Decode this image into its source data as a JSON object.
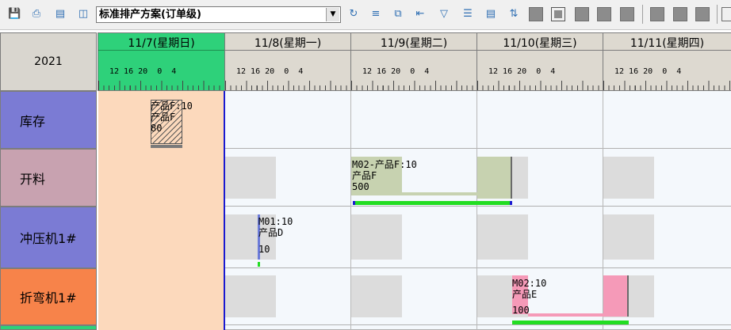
{
  "toolbar": {
    "plan_select": "标准排产方案(订单级)",
    "icons": [
      "save-icon",
      "print-icon",
      "print-preview-icon",
      "printer-icon",
      "refresh-icon",
      "align-icon",
      "copy-icon",
      "indent-icon",
      "filter-icon",
      "list-icon",
      "export-icon",
      "sort-icon"
    ]
  },
  "grid": {
    "year": "2021",
    "days": [
      {
        "title": "11/7(星期日)",
        "hours": "12 16 20  0  4"
      },
      {
        "title": "11/8(星期一)",
        "hours": "12 16 20  0  4"
      },
      {
        "title": "11/9(星期二)",
        "hours": "12 16 20  0  4"
      },
      {
        "title": "11/10(星期三)",
        "hours": "12 16 20  0  4"
      },
      {
        "title": "11/11(星期四)",
        "hours": "12 16 20  0  4"
      }
    ],
    "rows": [
      {
        "label": "库存",
        "color": "#7b7bd4"
      },
      {
        "label": "开料",
        "color": "#c8a2b0"
      },
      {
        "label": "冲压机1#",
        "color": "#7b7bd4"
      },
      {
        "label": "折弯机1#",
        "color": "#f7834a"
      }
    ]
  },
  "tasks": {
    "inventory": {
      "line1": "产品F:10",
      "line2": "产品F",
      "line3": "80"
    },
    "cutting": {
      "line1": "M02-产品F:10",
      "line2": "产品F",
      "line3": "500"
    },
    "press": {
      "line1": "M01:10",
      "line2": "产品D",
      "line3": "10"
    },
    "bend": {
      "line1": "M02:10",
      "line2": "产品E",
      "line3": "100"
    }
  },
  "colors": {
    "today_header": "#2ed17a",
    "today_col": "#fcd9bc",
    "progress": "#22dd22",
    "now_line": "#1a1ad0"
  }
}
